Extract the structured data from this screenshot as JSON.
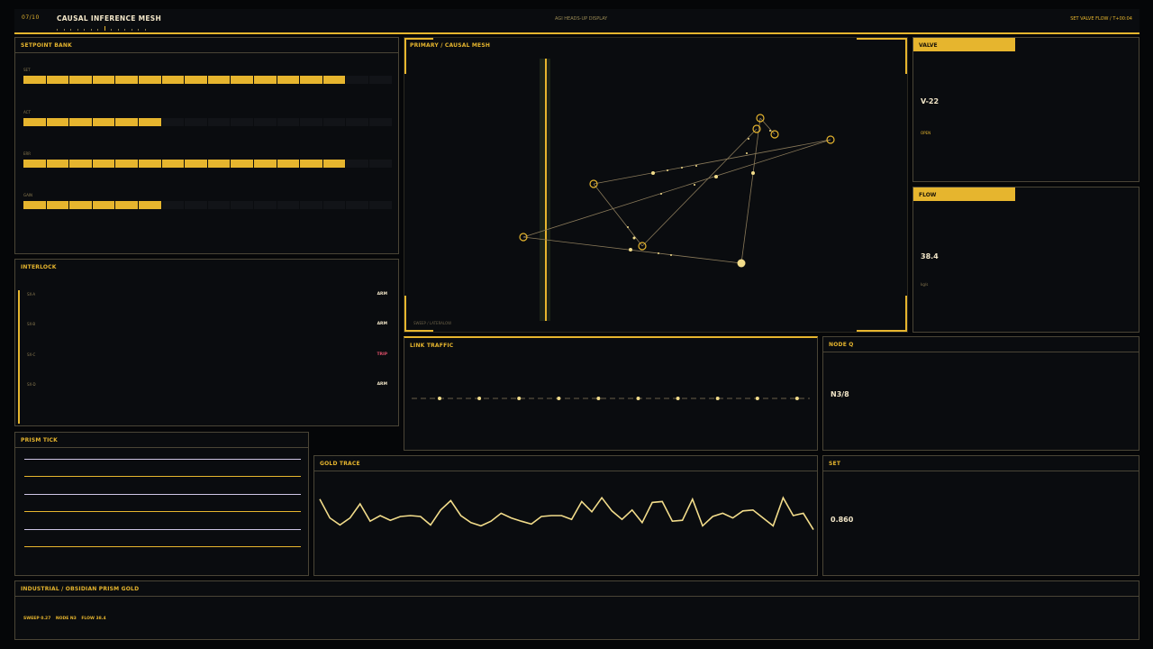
{
  "header": {
    "index": "07/10",
    "title": "CAUSAL INFERENCE MESH",
    "center": "AGI HEADS-UP DISPLAY",
    "right": "SET VALVE FLOW / T+00:04"
  },
  "setpoint_bank": {
    "title": "SETPOINT BANK",
    "rows": [
      {
        "label": "SET",
        "filled": 14,
        "total": 16
      },
      {
        "label": "ACT",
        "filled": 6,
        "total": 16
      },
      {
        "label": "ERR",
        "filled": 14,
        "total": 16
      },
      {
        "label": "GAIN",
        "filled": 6,
        "total": 16
      }
    ]
  },
  "interlock": {
    "title": "INTERLOCK",
    "items": [
      {
        "name": "SX-A",
        "state": "ARM"
      },
      {
        "name": "SX-B",
        "state": "ARM"
      },
      {
        "name": "SX-C",
        "state": "TRIP"
      },
      {
        "name": "SX-D",
        "state": "ARM"
      }
    ]
  },
  "prism_tick": {
    "title": "PRISM TICK",
    "lines": [
      "#cfc6e6",
      "#e6b52e",
      "#cfc6e6",
      "#e6b52e",
      "#cfc6e6",
      "#e6b52e"
    ]
  },
  "primary": {
    "title": "PRIMARY / CAUSAL MESH",
    "caption": "SWEEP / LATERALOW"
  },
  "valve": {
    "title": "VALVE",
    "value": "V-22",
    "sub": "OPEN"
  },
  "flow": {
    "title": "FLOW",
    "value": "38.4",
    "sub": "kg/s"
  },
  "link_traffic": {
    "title": "LINK TRAFFIC",
    "dots": 10
  },
  "node_q": {
    "title": "NODE Q",
    "value": "N3/8"
  },
  "gold_trace": {
    "title": "GOLD TRACE",
    "values": [
      0.85,
      0.45,
      0.3,
      0.45,
      0.75,
      0.38,
      0.5,
      0.4,
      0.48,
      0.5,
      0.48,
      0.3,
      0.62,
      0.82,
      0.5,
      0.35,
      0.28,
      0.38,
      0.55,
      0.45,
      0.38,
      0.32,
      0.48,
      0.5,
      0.5,
      0.42,
      0.8,
      0.58,
      0.88,
      0.6,
      0.42,
      0.62,
      0.35,
      0.78,
      0.8,
      0.38,
      0.4,
      0.85,
      0.28,
      0.48,
      0.55,
      0.45,
      0.6,
      0.62,
      0.45,
      0.28,
      0.88,
      0.5,
      0.55,
      0.2
    ]
  },
  "set": {
    "title": "SET",
    "value": "0.860"
  },
  "footer": {
    "title": "INDUSTRIAL / OBSIDIAN PRISM GOLD",
    "stats": [
      "SWEEP 0.27",
      "NODE N3",
      "FLOW 38.4"
    ]
  },
  "colors": {
    "accent": "#e6b52e",
    "trip": "#e0506a",
    "trace": "#f2dc8a",
    "bg": "#0a0c0f"
  }
}
